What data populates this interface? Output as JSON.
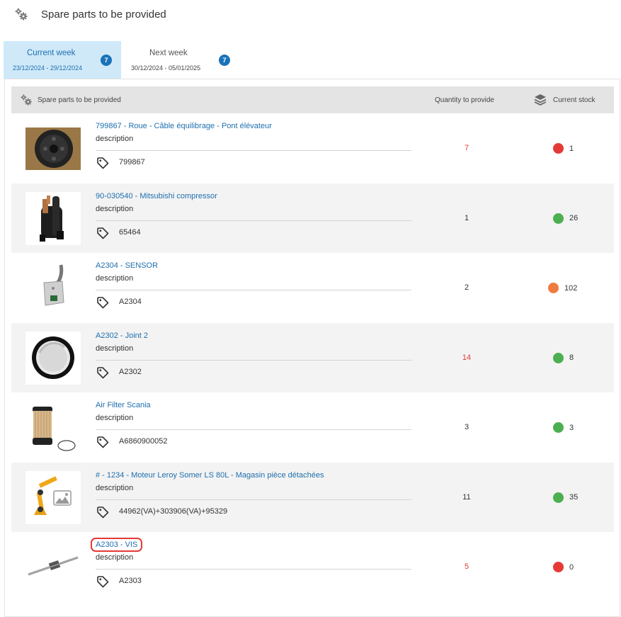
{
  "header": {
    "title": "Spare parts to be provided",
    "icon": "gears-icon"
  },
  "tabs": [
    {
      "label": "Current week",
      "dates": "23/12/2024 - 29/12/2024",
      "badge": "7",
      "active": true
    },
    {
      "label": "Next week",
      "dates": "30/12/2024 - 05/01/2025",
      "badge": "7",
      "active": false
    }
  ],
  "table": {
    "columns": {
      "parts": "Spare parts to be provided",
      "quantity": "Quantity to provide",
      "stock": "Current stock"
    },
    "rows": [
      {
        "name": "799867 - Roue - Câble équilibrage - Pont élévateur",
        "description": "description",
        "reference": "799867",
        "quantity": "7",
        "quantity_color": "red",
        "stock": "1",
        "stock_status": "red"
      },
      {
        "name": "90-030540 - Mitsubishi compressor",
        "description": "description",
        "reference": "65464",
        "quantity": "1",
        "quantity_color": "black",
        "stock": "26",
        "stock_status": "green"
      },
      {
        "name": "A2304 - SENSOR",
        "description": "description",
        "reference": "A2304",
        "quantity": "2",
        "quantity_color": "black",
        "stock": "102",
        "stock_status": "orange"
      },
      {
        "name": "A2302 - Joint 2",
        "description": "description",
        "reference": "A2302",
        "quantity": "14",
        "quantity_color": "red",
        "stock": "8",
        "stock_status": "green"
      },
      {
        "name": "Air Filter Scania",
        "description": "description",
        "reference": "A6860900052",
        "quantity": "3",
        "quantity_color": "black",
        "stock": "3",
        "stock_status": "green"
      },
      {
        "name": "# - 1234 - Moteur Leroy Somer LS 80L - Magasin pièce détachées",
        "description": "description",
        "reference": "44962(VA)+303906(VA)+95329",
        "quantity": "11",
        "quantity_color": "black",
        "stock": "35",
        "stock_status": "green"
      },
      {
        "name": "A2303 - VIS",
        "description": "description",
        "reference": "A2303",
        "quantity": "5",
        "quantity_color": "red",
        "stock": "0",
        "stock_status": "red"
      }
    ]
  },
  "colors": {
    "link": "#1f6fae",
    "active_tab_bg": "#cfe9f9",
    "badge": "#1a73b8",
    "status_red": "#e53935",
    "status_green": "#4caf50",
    "status_orange": "#f07b3f"
  }
}
